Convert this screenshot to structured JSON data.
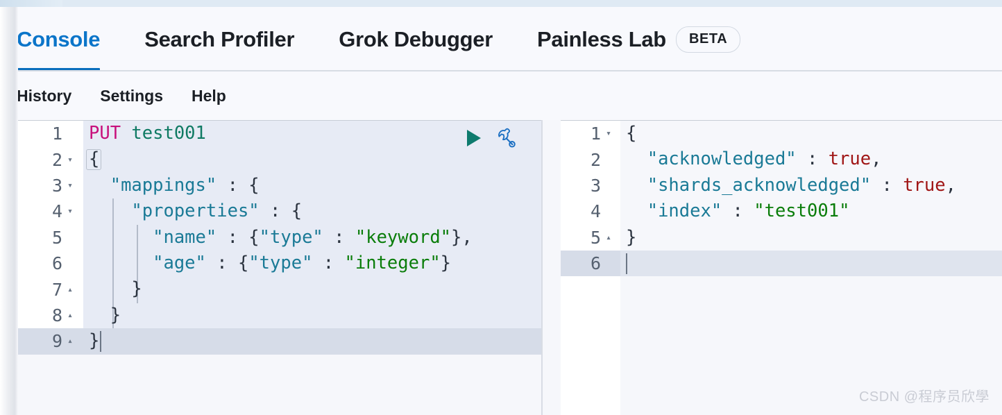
{
  "top_tabs": [
    {
      "label": "Console",
      "active": true,
      "badge": null
    },
    {
      "label": "Search Profiler",
      "active": false,
      "badge": null
    },
    {
      "label": "Grok Debugger",
      "active": false,
      "badge": null
    },
    {
      "label": "Painless Lab",
      "active": false,
      "badge": "BETA"
    }
  ],
  "submenu": [
    {
      "label": "History"
    },
    {
      "label": "Settings"
    },
    {
      "label": "Help"
    }
  ],
  "editor": {
    "actions": [
      {
        "name": "send-request-button",
        "icon": "play-icon",
        "color": "#0e7b6e"
      },
      {
        "name": "open-documentation-button",
        "icon": "wrench-icon",
        "color": "#1b6fc2"
      }
    ],
    "active_line": 9,
    "lines": [
      {
        "num": "1",
        "fold": "",
        "text": "PUT test001"
      },
      {
        "num": "2",
        "fold": "▾",
        "text": "{"
      },
      {
        "num": "3",
        "fold": "▾",
        "text": "  \"mappings\" : {"
      },
      {
        "num": "4",
        "fold": "▾",
        "text": "    \"properties\" : {"
      },
      {
        "num": "5",
        "fold": "",
        "text": "      \"name\" : {\"type\" : \"keyword\"},"
      },
      {
        "num": "6",
        "fold": "",
        "text": "      \"age\" : {\"type\" : \"integer\"}"
      },
      {
        "num": "7",
        "fold": "▴",
        "text": "    }"
      },
      {
        "num": "8",
        "fold": "▴",
        "text": "  }"
      },
      {
        "num": "9",
        "fold": "▴",
        "text": "}"
      }
    ]
  },
  "response": {
    "active_line": 6,
    "lines": [
      {
        "num": "1",
        "fold": "▾",
        "text": "{"
      },
      {
        "num": "2",
        "fold": "",
        "text": "  \"acknowledged\" : true,"
      },
      {
        "num": "3",
        "fold": "",
        "text": "  \"shards_acknowledged\" : true,"
      },
      {
        "num": "4",
        "fold": "",
        "text": "  \"index\" : \"test001\""
      },
      {
        "num": "5",
        "fold": "▴",
        "text": "}"
      },
      {
        "num": "6",
        "fold": "",
        "text": ""
      }
    ]
  },
  "watermark": {
    "text": "CSDN @程序员欣學"
  },
  "colors": {
    "accent": "#0a6ebd",
    "method": "#c8117c",
    "url": "#0f7a63",
    "key": "#1a7a96",
    "string": "#0a7d0a",
    "bool": "#a01616",
    "editor_bg": "#e7ebf5",
    "active_line": "#d6dce8"
  }
}
